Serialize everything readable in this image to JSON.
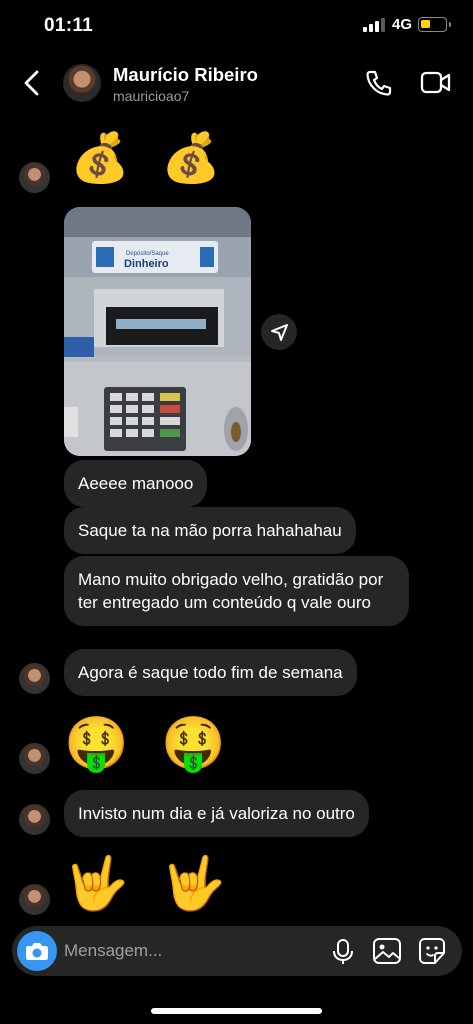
{
  "status_bar": {
    "time": "01:11",
    "network": "4G"
  },
  "header": {
    "name": "Maurício Ribeiro",
    "username": "mauricioao7"
  },
  "messages": {
    "emoji_1": "💰 💰",
    "photo_labels": {
      "top": "Depósito/Saque",
      "main": "Dinheiro"
    },
    "text_1": "Aeeee manooo",
    "text_2": "Saque ta na mão porra hahahahau",
    "text_3": "Mano muito obrigado velho, gratidão por ter entregado um conteúdo q vale ouro",
    "text_4": "Agora é saque todo fim de semana",
    "emoji_2": "🤑 🤑",
    "text_5": "Invisto num dia e já valoriza no outro",
    "emoji_3": "🤟 🤟"
  },
  "composer": {
    "placeholder": "Mensagem..."
  },
  "colors": {
    "background": "#000000",
    "bubble": "#262626",
    "camera": "#3797f0",
    "battery": "#ffd60a"
  }
}
